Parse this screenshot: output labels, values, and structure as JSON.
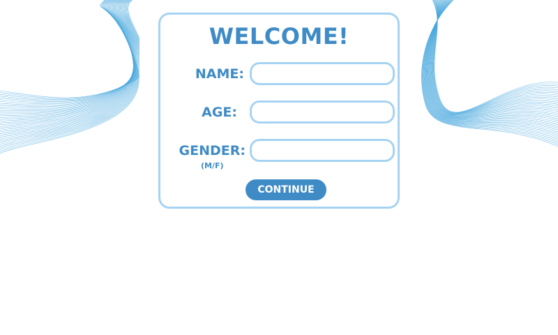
{
  "form": {
    "title": "WELCOME!",
    "fields": [
      {
        "label": "NAME:",
        "value": "",
        "placeholder": ""
      },
      {
        "label": "AGE:",
        "value": "",
        "placeholder": ""
      },
      {
        "label": "GENDER:",
        "sublabel": "(M/F)",
        "value": "",
        "placeholder": ""
      }
    ],
    "continue_label": "CONTINUE"
  },
  "colors": {
    "accent": "#3f8bc6",
    "border": "#a6d3f3",
    "wave": "#4aa8de",
    "background": "#ffffff"
  },
  "decorations": {
    "left": "wave-lines",
    "right": "wave-lines"
  }
}
